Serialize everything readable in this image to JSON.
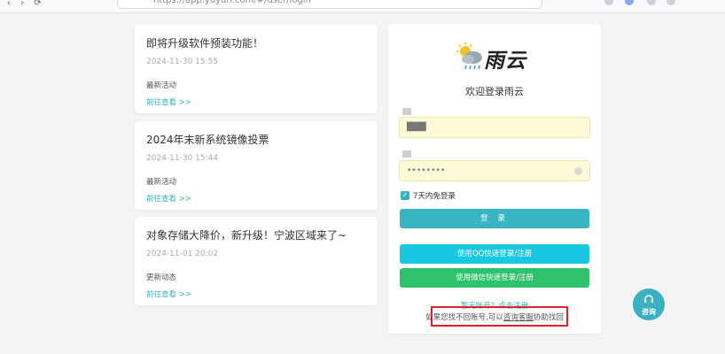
{
  "browser": {
    "url": "https://app.yuyun.com/#/user/login"
  },
  "news": [
    {
      "title": "即将升级软件预装功能！",
      "date": "2024-11-30 15:55",
      "category": "最新活动",
      "link": "前往查看 >>"
    },
    {
      "title": "2024年末新系统镜像投票",
      "date": "2024-11-30 15:44",
      "category": "最新活动",
      "link": "前往查看 >>"
    },
    {
      "title": "对象存储大降价，新升级！宁波区域来了~",
      "date": "2024-11-01 20:02",
      "category": "更新动态",
      "link": "前往查看 >>"
    }
  ],
  "login": {
    "logo_text": "雨云",
    "welcome": "欢迎登录雨云",
    "username_value": "████",
    "password_value": "••••••••",
    "remember_label": "7天内免登录",
    "login_button": "登 录",
    "qq_button": "使用QQ快速登录/注册",
    "wechat_button": "使用微信快速登录/注册",
    "register_link": "暂无账号？点击注册",
    "help_prefix": "如果您找不回账号,可以",
    "help_service": "咨询客服",
    "help_suffix": "协助找回"
  },
  "consult": {
    "label": "咨询"
  },
  "colors": {
    "accent": "#3ab0c0",
    "qq": "#18c7e0",
    "wechat": "#2ec36b",
    "highlight": "#d9252a"
  },
  "icons": [
    "weather-logo-icon",
    "check-icon",
    "eye-icon",
    "headset-icon"
  ]
}
